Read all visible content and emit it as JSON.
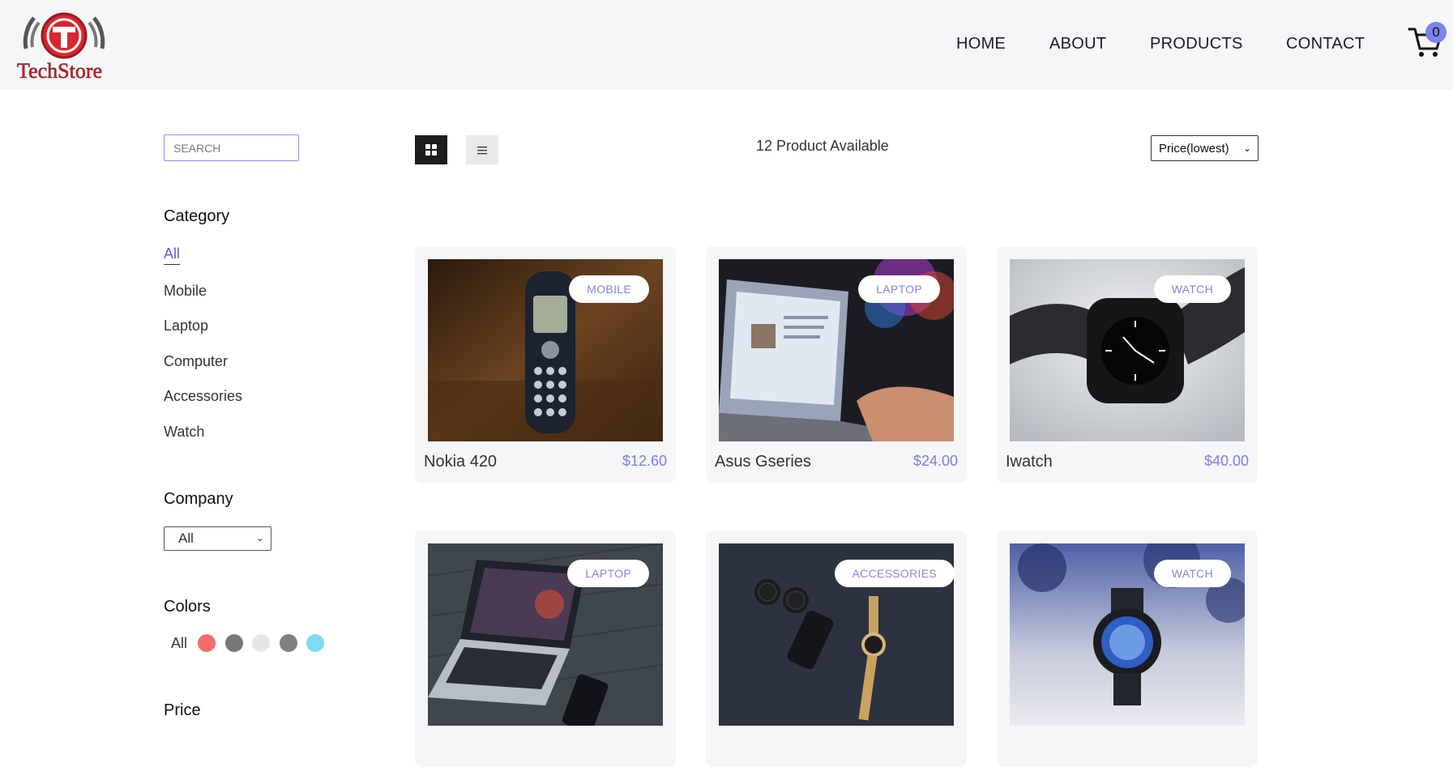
{
  "header": {
    "logo_text": "TechStore",
    "nav": [
      {
        "label": "HOME"
      },
      {
        "label": "ABOUT"
      },
      {
        "label": "PRODUCTS"
      },
      {
        "label": "CONTACT"
      }
    ],
    "cart_count": "0"
  },
  "sidebar": {
    "search_placeholder": "SEARCH",
    "category_heading": "Category",
    "categories": [
      "All",
      "Mobile",
      "Laptop",
      "Computer",
      "Accessories",
      "Watch"
    ],
    "active_category": "All",
    "company_heading": "Company",
    "company_value": "All",
    "colors_heading": "Colors",
    "colors_all_label": "All",
    "colors": [
      "#f26d6d",
      "#777777",
      "#e6e6e6",
      "#808080",
      "#7ddcf2"
    ],
    "price_heading": "Price"
  },
  "toolbar": {
    "count_text": "12 Product Available",
    "sort_value": "Price(lowest)"
  },
  "products": [
    {
      "name": "Nokia 420",
      "price": "$12.60",
      "tag": "MOBILE",
      "image": "nokia-phone-photo"
    },
    {
      "name": "Asus Gseries",
      "price": "$24.00",
      "tag": "LAPTOP",
      "image": "laptop-typing-photo"
    },
    {
      "name": "Iwatch",
      "price": "$40.00",
      "tag": "WATCH",
      "image": "smartwatch-photo"
    },
    {
      "name": "",
      "price": "",
      "tag": "LAPTOP",
      "image": "macbook-photo"
    },
    {
      "name": "",
      "price": "",
      "tag": "ACCESSORIES",
      "image": "accessories-photo"
    },
    {
      "name": "",
      "price": "",
      "tag": "WATCH",
      "image": "round-watch-photo"
    }
  ]
}
